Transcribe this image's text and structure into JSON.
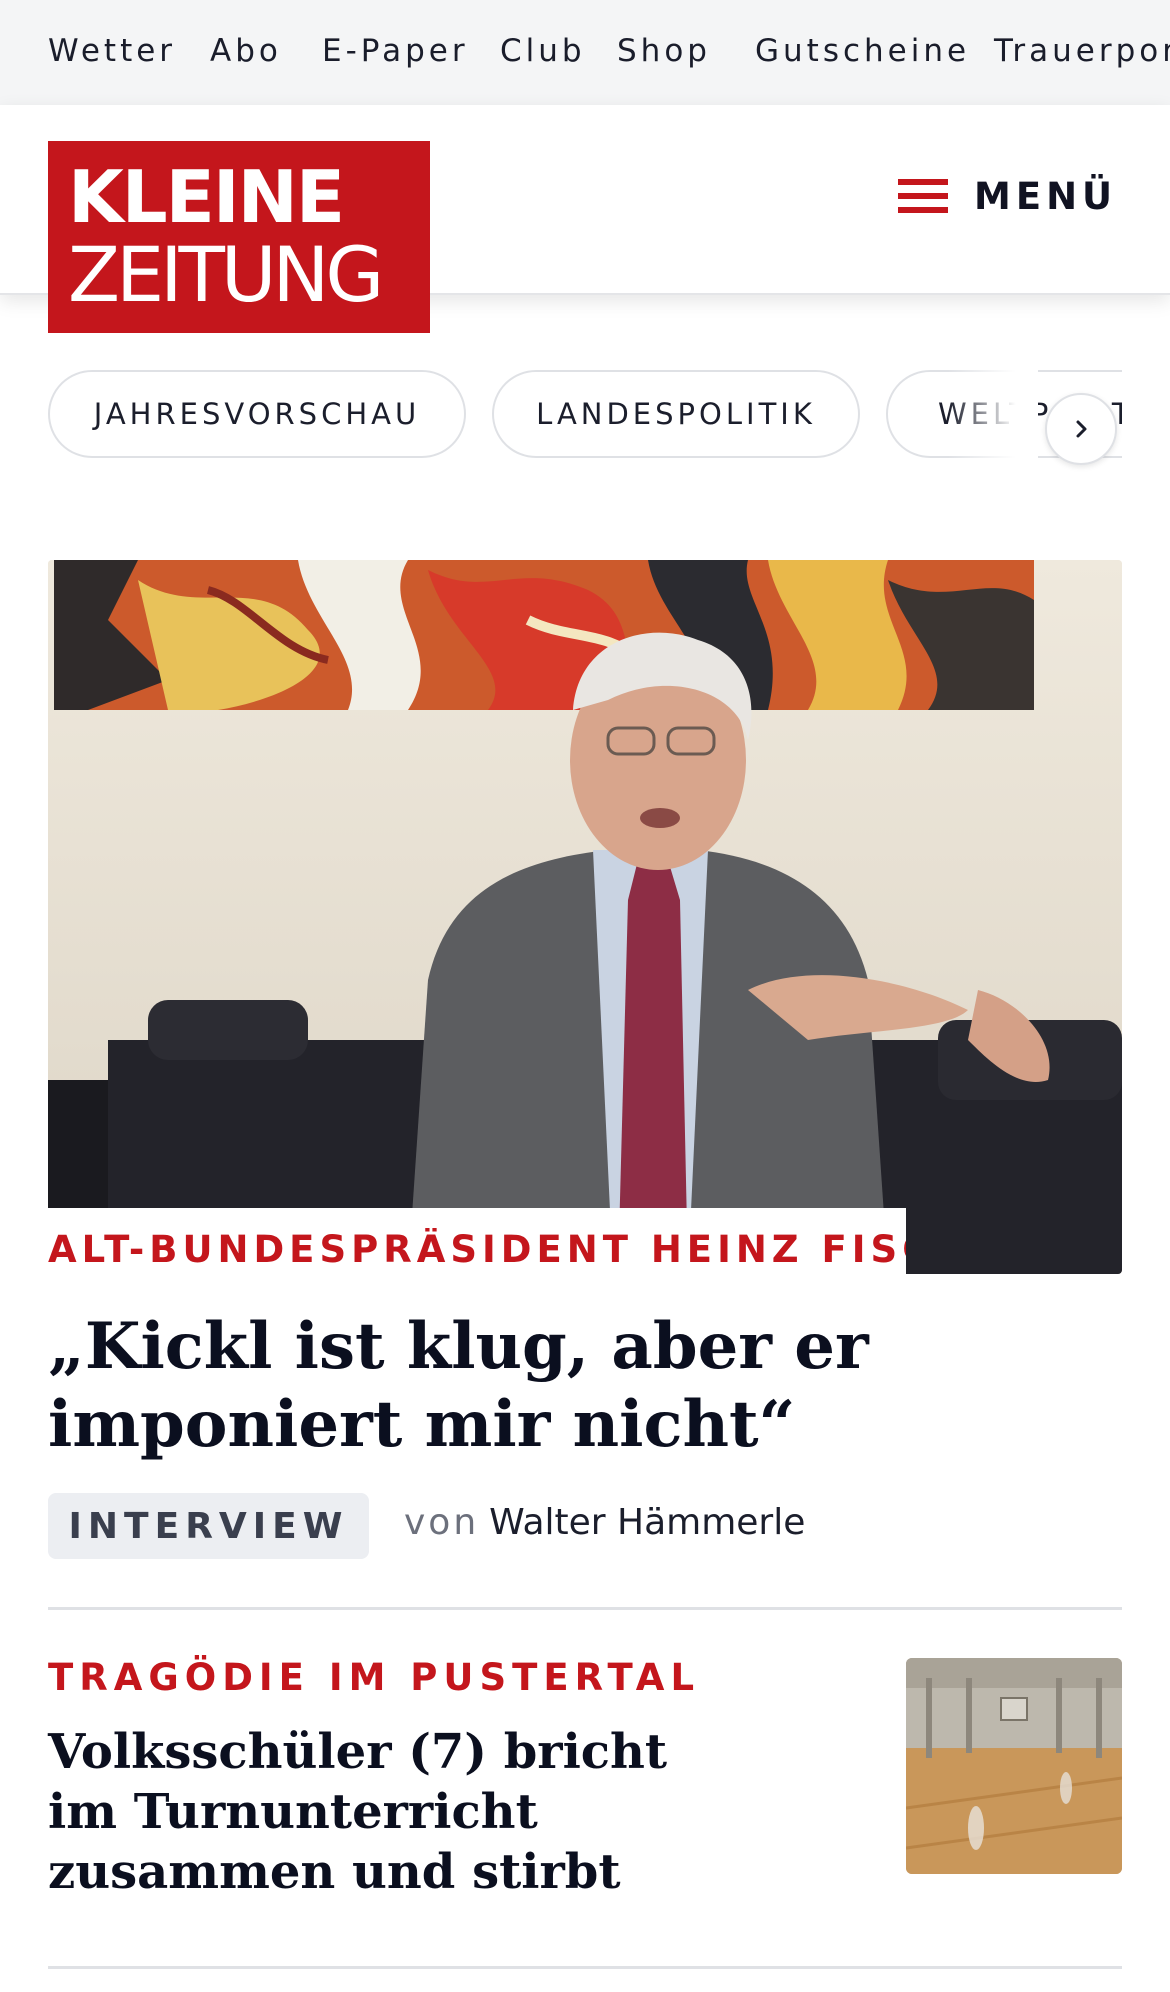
{
  "top_nav": {
    "items": [
      "Wetter",
      "Abo",
      "E-Paper",
      "Club",
      "Shop",
      "Gutscheine",
      "Trauerportal"
    ]
  },
  "header": {
    "logo_line1": "KLEINE",
    "logo_line2": "ZEITUNG",
    "menu_label": "MENÜ"
  },
  "topics": {
    "chips": [
      "JAHRESVORSCHAU",
      "LANDESPOLITIK",
      "WELTPOLITIK"
    ]
  },
  "lead_story": {
    "kicker": "ALT-BUNDESPRÄSIDENT HEINZ FISC…",
    "headline": "„Kickl ist klug, aber er imponiert mir nicht“",
    "badge": "INTERVIEW",
    "byline_prefix": "von",
    "author": "Walter Hämmerle"
  },
  "second_story": {
    "kicker": "TRAGÖDIE IM PUSTERTAL",
    "headline": "Volksschüler (7) bricht im Turnunterricht zusammen und stirbt"
  },
  "colors": {
    "brand_red": "#c4161c",
    "text_dark": "#0b0f1f",
    "nav_bg": "#f4f5f6"
  }
}
